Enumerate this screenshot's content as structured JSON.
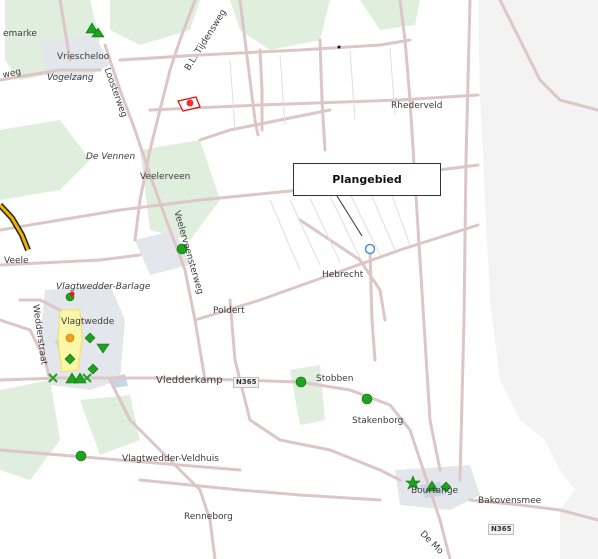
{
  "map": {
    "callout_label": "Plangebied",
    "road_shield_1": "N365",
    "road_shield_2": "N365",
    "labels": {
      "gemarke": "emarke",
      "vriescheloo": "Vriescheloo",
      "weg": "weg",
      "vogelzang": "Vogelzang",
      "loosterweg": "Loosterweg",
      "bl_tijdensweg": "B.L. Tijdensweg",
      "rhederveld": "Rhederveld",
      "de_vennen": "De Vennen",
      "veelerveen": "Veelerveen",
      "veele": "Veele",
      "veelerveensterweg": "Veelerveensterweg",
      "hebrecht": "Hebrecht",
      "vlagtwedder_barlage": "Vlagtwedder-Barlage",
      "poldert": "Poldert",
      "vlagtwedde": "Vlagtwedde",
      "wedderstraat": "Wedderstraat",
      "vledderkamp": "Vledderkamp",
      "stobben": "Stobben",
      "stakenborg": "Stakenborg",
      "vlagtwedder_veldhuis": "Vlagtwedder-Veldhuis",
      "bourtange": "Bourtange",
      "bakovensmee": "Bakovensmee",
      "renneborg": "Renneborg",
      "de_mo": "De Mo"
    },
    "colors": {
      "road": "#dcc8c8",
      "water": "#aebfd4",
      "built": "#d8dde2",
      "forest": "#dceedc",
      "highway": "#f0b400",
      "marker_green": "#1ea31e",
      "marker_red": "#e02020",
      "study_area": "#4a90d9"
    }
  }
}
